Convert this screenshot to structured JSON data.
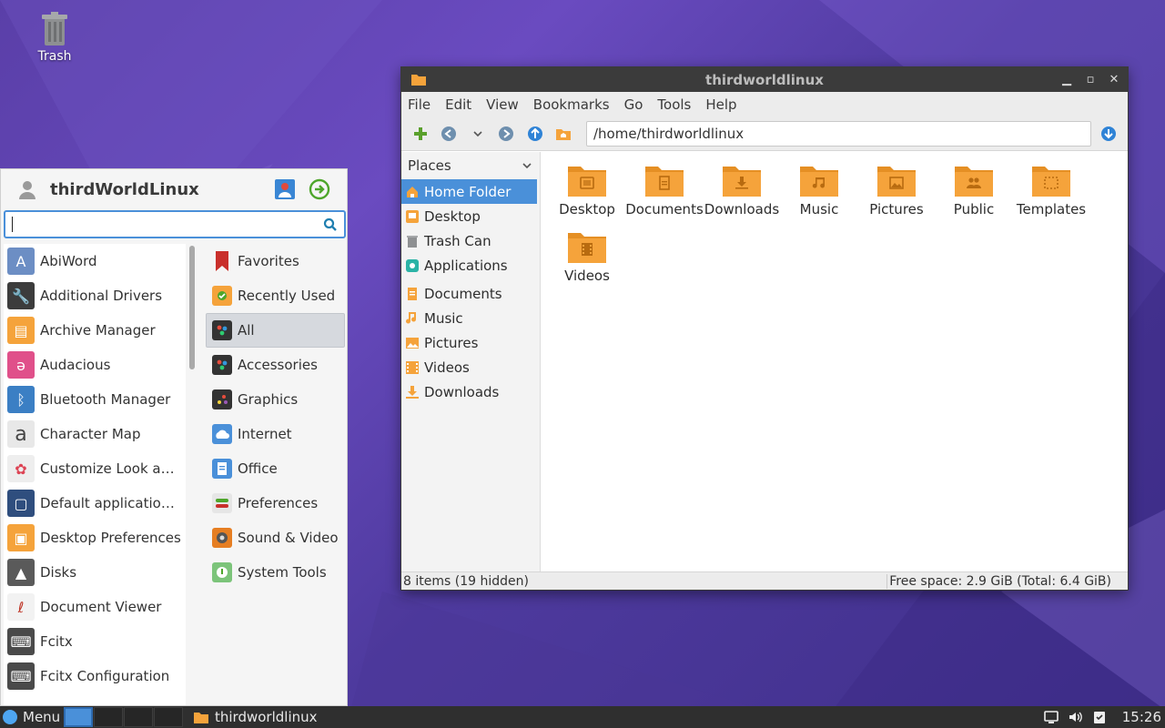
{
  "desktop": {
    "icons": [
      {
        "label": "Trash"
      }
    ]
  },
  "file_manager": {
    "title": "thirdworldlinux",
    "menu": [
      "File",
      "Edit",
      "View",
      "Bookmarks",
      "Go",
      "Tools",
      "Help"
    ],
    "path": "/home/thirdworldlinux",
    "places_header": "Places",
    "places": [
      {
        "label": "Home Folder",
        "icon": "home-icon"
      },
      {
        "label": "Desktop",
        "icon": "desktop-icon"
      },
      {
        "label": "Trash Can",
        "icon": "trash-icon"
      },
      {
        "label": "Applications",
        "icon": "applications-icon"
      }
    ],
    "bookmarks": [
      {
        "label": "Documents",
        "icon": "documents-icon"
      },
      {
        "label": "Music",
        "icon": "music-icon"
      },
      {
        "label": "Pictures",
        "icon": "pictures-icon"
      },
      {
        "label": "Videos",
        "icon": "videos-icon"
      },
      {
        "label": "Downloads",
        "icon": "downloads-icon"
      }
    ],
    "files": [
      {
        "label": "Desktop",
        "icon": "desktop-folder-icon"
      },
      {
        "label": "Documents",
        "icon": "documents-folder-icon"
      },
      {
        "label": "Downloads",
        "icon": "downloads-folder-icon"
      },
      {
        "label": "Music",
        "icon": "music-folder-icon"
      },
      {
        "label": "Pictures",
        "icon": "pictures-folder-icon"
      },
      {
        "label": "Public",
        "icon": "public-folder-icon"
      },
      {
        "label": "Templates",
        "icon": "templates-folder-icon"
      },
      {
        "label": "Videos",
        "icon": "videos-folder-icon"
      }
    ],
    "status_left": "8 items (19 hidden)",
    "status_right": "Free space: 2.9 GiB (Total: 6.4 GiB)",
    "colors": {
      "selection": "#4a90d9",
      "folder": "#f5a33b"
    }
  },
  "app_menu": {
    "username": "thirdWorldLinux",
    "search_value": "",
    "apps": [
      {
        "label": "AbiWord",
        "icon": "abiword-icon"
      },
      {
        "label": "Additional Drivers",
        "icon": "wrench-icon"
      },
      {
        "label": "Archive Manager",
        "icon": "archive-icon"
      },
      {
        "label": "Audacious",
        "icon": "audacious-icon"
      },
      {
        "label": "Bluetooth Manager",
        "icon": "bluetooth-icon"
      },
      {
        "label": "Character Map",
        "icon": "character-map-icon"
      },
      {
        "label": "Customize Look and Feel",
        "icon": "customize-icon"
      },
      {
        "label": "Default applications for LXSession",
        "icon": "default-apps-icon"
      },
      {
        "label": "Desktop Preferences",
        "icon": "desktop-prefs-icon"
      },
      {
        "label": "Disks",
        "icon": "disks-icon"
      },
      {
        "label": "Document Viewer",
        "icon": "document-viewer-icon"
      },
      {
        "label": "Fcitx",
        "icon": "keyboard-icon"
      },
      {
        "label": "Fcitx Configuration",
        "icon": "keyboard-icon"
      }
    ],
    "categories": [
      {
        "label": "Favorites",
        "icon": "bookmark-icon"
      },
      {
        "label": "Recently Used",
        "icon": "recent-icon"
      },
      {
        "label": "All",
        "icon": "all-icon"
      },
      {
        "label": "Accessories",
        "icon": "accessories-icon"
      },
      {
        "label": "Graphics",
        "icon": "graphics-icon"
      },
      {
        "label": "Internet",
        "icon": "internet-icon"
      },
      {
        "label": "Office",
        "icon": "office-icon"
      },
      {
        "label": "Preferences",
        "icon": "preferences-icon"
      },
      {
        "label": "Sound & Video",
        "icon": "sound-video-icon"
      },
      {
        "label": "System Tools",
        "icon": "system-tools-icon"
      }
    ]
  },
  "taskbar": {
    "menu_label": "Menu",
    "task_label": "thirdworldlinux",
    "clock": "15:26"
  }
}
